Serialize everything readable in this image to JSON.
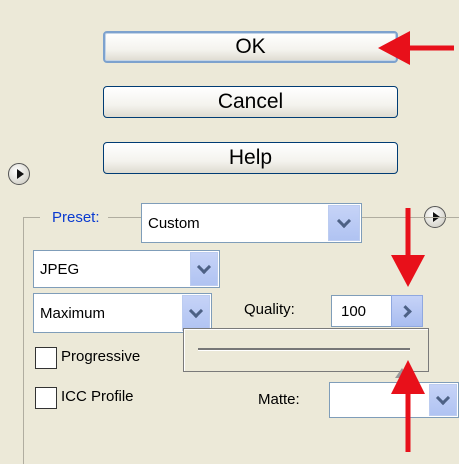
{
  "buttons": {
    "ok": "OK",
    "cancel": "Cancel",
    "help": "Help"
  },
  "preset": {
    "label": "Preset:",
    "value": "Custom"
  },
  "format": {
    "value": "JPEG"
  },
  "compression": {
    "value": "Maximum"
  },
  "quality": {
    "label": "Quality:",
    "value": "100",
    "slider_fraction": 0.96
  },
  "options": {
    "progressive_label": "Progressive",
    "progressive_checked": false,
    "icc_label": "ICC Profile",
    "icc_checked": false
  },
  "matte": {
    "label": "Matte:",
    "value": ""
  },
  "colors": {
    "annotation_arrow": "#e8101a",
    "preset_label": "#0a3ad0",
    "panel_background": "#ece9d8"
  },
  "icons": [
    "menu-arrow-icon",
    "dropdown-chevron-icon",
    "chevron-right-icon",
    "slider-thumb-icon",
    "annotation-arrow-icon"
  ]
}
